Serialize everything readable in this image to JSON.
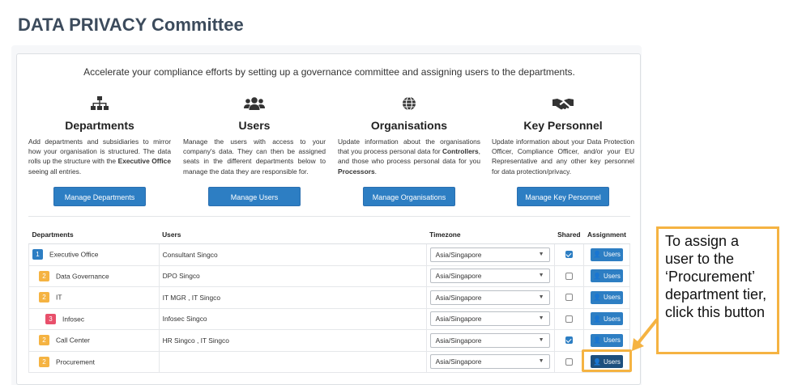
{
  "page_title": "DATA PRIVACY Committee",
  "intro": "Accelerate your compliance efforts by setting up a governance committee and assigning users to the departments.",
  "features": [
    {
      "icon": "sitemap-icon",
      "title": "Departments",
      "desc_parts": [
        "Add departments and subsidiaries to mirror how your organisation is structured. The data rolls up the structure with the ",
        "Executive Office",
        " seeing all entries."
      ],
      "button": "Manage Departments"
    },
    {
      "icon": "users-icon",
      "title": "Users",
      "desc_parts": [
        "Manage the users with access to your company's data. They can then be assigned seats in the different departments below to manage the data they are responsible for."
      ],
      "button": "Manage Users"
    },
    {
      "icon": "globe-icon",
      "title": "Organisations",
      "desc_parts": [
        "Update information about the organisations that you process personal data for ",
        "Controllers",
        ", and those who process personal data for you ",
        "Processors",
        "."
      ],
      "button": "Manage Organisations"
    },
    {
      "icon": "handshake-icon",
      "title": "Key Personnel",
      "desc_parts": [
        "Update information about your Data Protection Officer, Compliance Officer, and/or your EU Representative and any other key personnel for data protection/privacy."
      ],
      "button": "Manage Key Personnel"
    }
  ],
  "table": {
    "headers": [
      "Departments",
      "Users",
      "Timezone",
      "Shared",
      "Assignment"
    ],
    "rows": [
      {
        "level": "1",
        "name": "Executive Office",
        "users": "Consultant Singco",
        "timezone": "Asia/Singapore",
        "shared": true,
        "button": "Users"
      },
      {
        "level": "2",
        "name": "Data Governance",
        "users": "DPO Singco",
        "timezone": "Asia/Singapore",
        "shared": false,
        "button": "Users"
      },
      {
        "level": "2",
        "name": "IT",
        "users": "IT MGR , IT Singco",
        "timezone": "Asia/Singapore",
        "shared": false,
        "button": "Users"
      },
      {
        "level": "3",
        "name": "Infosec",
        "users": "Infosec Singco",
        "timezone": "Asia/Singapore",
        "shared": false,
        "button": "Users"
      },
      {
        "level": "2",
        "name": "Call Center",
        "users": "HR Singco , IT Singco",
        "timezone": "Asia/Singapore",
        "shared": true,
        "button": "Users"
      },
      {
        "level": "2",
        "name": "Procurement",
        "users": "",
        "timezone": "Asia/Singapore",
        "shared": false,
        "button": "Users"
      }
    ]
  },
  "callout": "To assign a user to the ‘Procurement’ department tier, click this button",
  "colors": {
    "accent": "#2d7ec3",
    "highlight": "#f5b342",
    "level2": "#f5b342",
    "level3": "#e8506b"
  }
}
